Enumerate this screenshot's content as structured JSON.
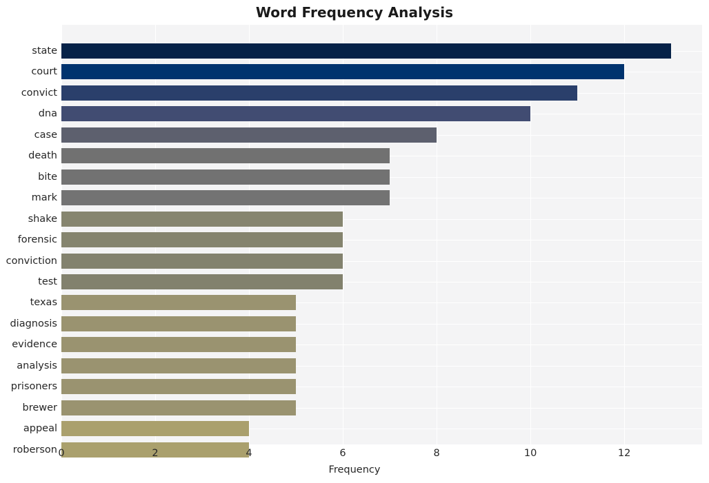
{
  "chart_data": {
    "type": "bar",
    "orientation": "horizontal",
    "title": "Word Frequency Analysis",
    "xlabel": "Frequency",
    "ylabel": "",
    "categories": [
      "state",
      "court",
      "convict",
      "dna",
      "case",
      "death",
      "bite",
      "mark",
      "shake",
      "forensic",
      "conviction",
      "test",
      "texas",
      "diagnosis",
      "evidence",
      "analysis",
      "prisoners",
      "brewer",
      "appeal",
      "roberson"
    ],
    "values": [
      13,
      12,
      11,
      10,
      8,
      7,
      7,
      7,
      6,
      6,
      6,
      6,
      5,
      5,
      5,
      5,
      5,
      5,
      4,
      4
    ],
    "bar_colors": [
      "#062248",
      "#00336e",
      "#2a3f6b",
      "#414c72",
      "#5d606e",
      "#717171",
      "#727272",
      "#737373",
      "#86856f",
      "#85846e",
      "#83826e",
      "#82816d",
      "#9a9370",
      "#9a9370",
      "#9a9370",
      "#9a9370",
      "#9a9370",
      "#9a9370",
      "#aaa06d",
      "#aaa06d"
    ],
    "xlim": [
      0,
      13.66
    ],
    "xticks": [
      0,
      2,
      4,
      6,
      8,
      10,
      12
    ],
    "xtick_labels": [
      "0",
      "2",
      "4",
      "6",
      "8",
      "10",
      "12"
    ],
    "grid": true,
    "grid_color": "#ffffff",
    "legend": "none",
    "plot_background": "#f4f4f5",
    "figure_background": "#ffffff",
    "title_color": "#1a1a1a",
    "tick_color": "#262626"
  }
}
